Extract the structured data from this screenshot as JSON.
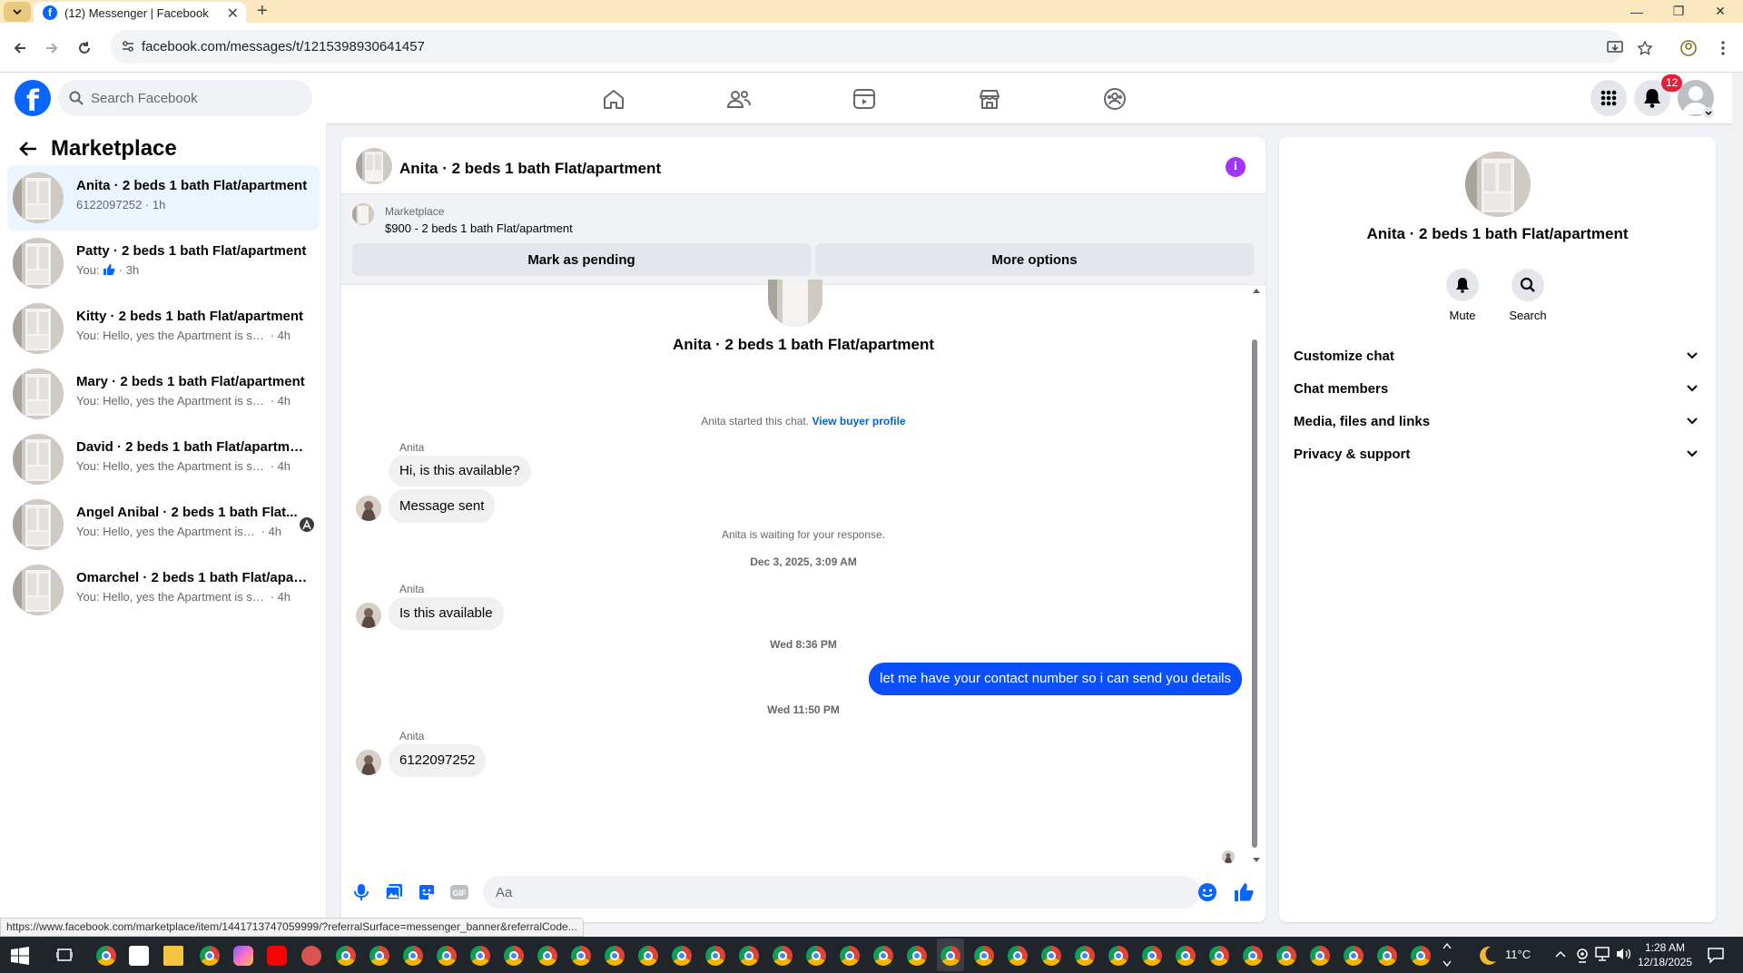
{
  "browser": {
    "tab_title": "(12) Messenger | Facebook",
    "url": "facebook.com/messages/t/1215398930641457",
    "status_url": "https://www.facebook.com/marketplace/item/1441713747059999/?referralSurface=messenger_banner&referralCode..."
  },
  "header": {
    "search_placeholder": "Search Facebook",
    "notification_count": "12"
  },
  "left": {
    "title": "Marketplace",
    "conversations": [
      {
        "name": "Anita · 2 beds 1 bath Flat/apartment",
        "snippet": "6122097252",
        "time": "1h",
        "active": true
      },
      {
        "name": "Patty · 2 beds 1 bath Flat/apartment",
        "snippet": "You:",
        "time": "3h",
        "like_icon": true
      },
      {
        "name": "Kitty · 2 beds 1 bath Flat/apartment",
        "snippet": "You: Hello, yes the Apartment is still a...",
        "time": "4h"
      },
      {
        "name": "Mary · 2 beds 1 bath Flat/apartment",
        "snippet": "You: Hello, yes the Apartment is still a...",
        "time": "4h"
      },
      {
        "name": "David · 2 beds 1 bath Flat/apartment",
        "snippet": "You: Hello, yes the Apartment is still a...",
        "time": "4h"
      },
      {
        "name": "Angel Anibal · 2 beds 1 bath Flat...",
        "snippet": "You: Hello, yes the Apartment is stil...",
        "time": "4h",
        "seen_icon": true
      },
      {
        "name": "Omarchel · 2 beds 1 bath Flat/apar...",
        "snippet": "You: Hello, yes the Apartment is still a...",
        "time": "4h"
      }
    ]
  },
  "chat": {
    "title": "Anita · 2 beds 1 bath Flat/apartment",
    "marketplace_label": "Marketplace",
    "listing": "$900 - 2 beds 1 bath Flat/apartment",
    "mark_pending": "Mark as pending",
    "more_options": "More options",
    "started_text": "Anita started this chat.",
    "view_profile": "View buyer profile",
    "msg1_sender": "Anita",
    "msg1a": "Hi, is this available?",
    "msg1b": "Message sent",
    "waiting": "Anita is waiting for your response.",
    "ts1": "Dec 3, 2025, 3:09 AM",
    "msg2_sender": "Anita",
    "msg2": "Is this available",
    "ts2": "Wed 8:36 PM",
    "msg_out": "let me have your contact number so i can send you details",
    "ts3": "Wed 11:50 PM",
    "msg3_sender": "Anita",
    "msg3": "6122097252",
    "input_placeholder": "Aa"
  },
  "right": {
    "title": "Anita · 2 beds 1 bath Flat/apartment",
    "mute": "Mute",
    "search": "Search",
    "sections": [
      "Customize chat",
      "Chat members",
      "Media, files and links",
      "Privacy & support"
    ]
  },
  "taskbar": {
    "temperature": "11°C",
    "time": "1:28 AM",
    "date": "12/18/2025"
  },
  "colors": {
    "brand": "#0866ff",
    "outgoing_bubble": "#0a4fff",
    "info_purple": "#a033ff",
    "badge_red": "#e41e3f"
  }
}
